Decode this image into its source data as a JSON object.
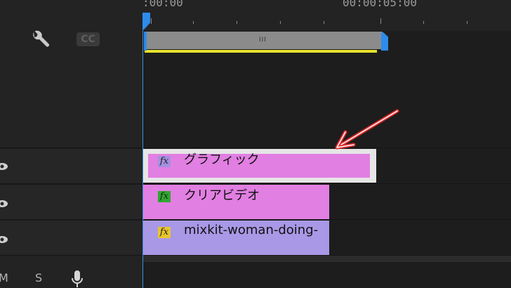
{
  "ruler": {
    "timecode_start": ":00:00",
    "timecode_mid": "00:00:05:00"
  },
  "work_area": {
    "grip": "III"
  },
  "header": {
    "wrench": "wrench-icon",
    "captions_label": "CC"
  },
  "tracks": [
    {
      "id": "V3",
      "clip_name": "グラフィック",
      "clip_color": "#e27fe2",
      "fx_color": "#a48fe0",
      "selected": true
    },
    {
      "id": "V2",
      "clip_name": "クリアビデオ",
      "clip_color": "#e27fe2",
      "fx_color": "#2fa82f"
    },
    {
      "id": "V1",
      "clip_name": "mixkit-woman-doing-",
      "clip_color": "#a898e6",
      "fx_color": "#e8c52c"
    }
  ],
  "fx_label": "fx",
  "bottom_labels": {
    "mute": "M",
    "solo": "S",
    "mic": "mic-icon"
  },
  "annotation": {
    "arrow_color": "#e52b2b"
  },
  "colors": {
    "playhead": "#2d8ceb",
    "work_area_yellow": "#e8e22c"
  }
}
